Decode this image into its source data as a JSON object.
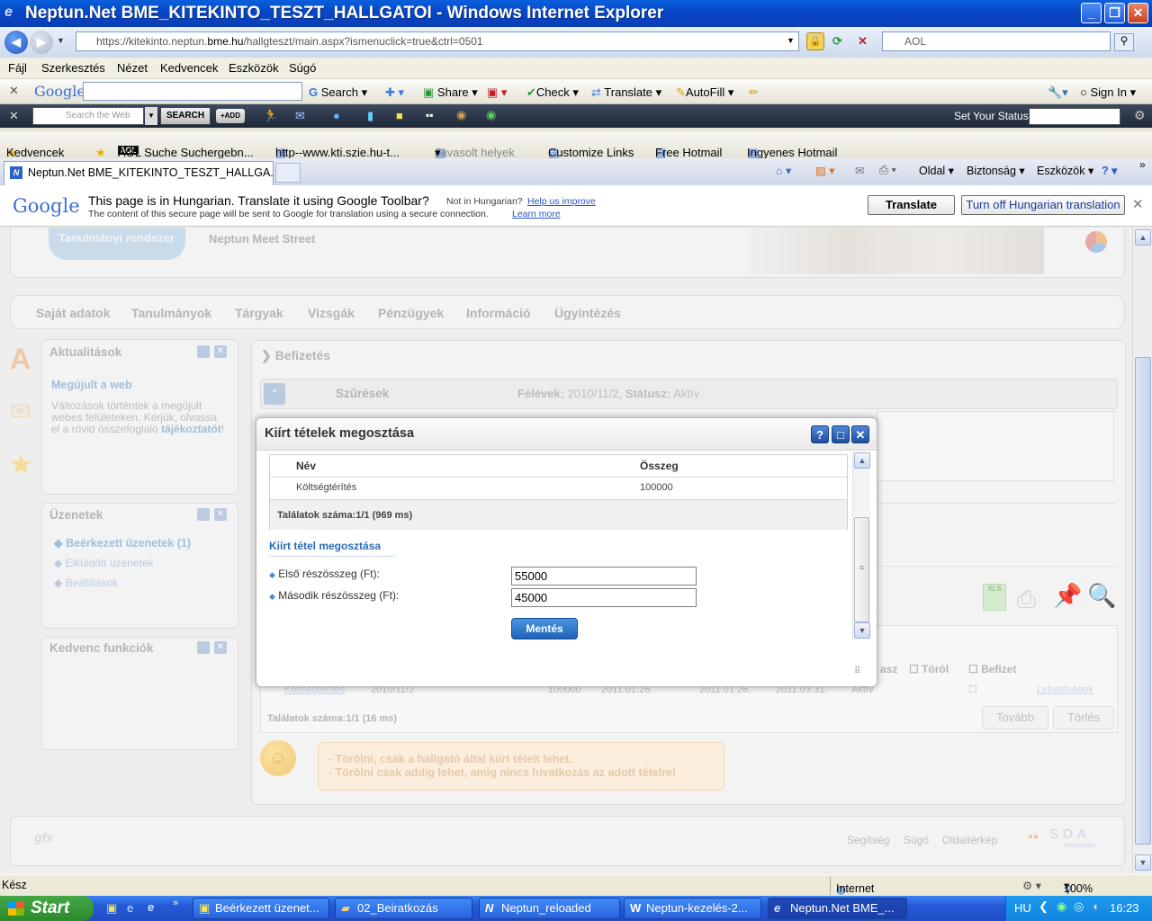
{
  "window": {
    "title": "Neptun.Net BME_KITEKINTO_TESZT_HALLGATOI - Windows Internet Explorer",
    "minimize": "_",
    "restore": "❐",
    "close": "✕"
  },
  "address": {
    "prefix": "https://kitekinto.neptun.",
    "domain": "bme.hu",
    "path": "/hallgteszt/main.aspx?ismenuclick=true&ctrl=0501",
    "search_placeholder": "AOL"
  },
  "menu": [
    "Fájl",
    "Szerkesztés",
    "Nézet",
    "Kedvencek",
    "Eszközök",
    "Súgó"
  ],
  "google_toolbar": {
    "logo": "Google",
    "search": "Search",
    "share": "Share",
    "check": "Check",
    "translate": "Translate",
    "autofill": "AutoFill",
    "signin": "Sign In"
  },
  "aol_toolbar": {
    "search_placeholder": "Search the Web",
    "search_btn": "SEARCH",
    "add_btn": "+ADD",
    "status_label": "Set Your Status:"
  },
  "favorites": {
    "label": "Kedvencek",
    "items": [
      "AOL Suche Suchergebn...",
      "http--www.kti.szie.hu-t...",
      "Javasolt helyek",
      "Customize Links",
      "Free Hotmail",
      "Ingyenes Hotmail"
    ]
  },
  "tabs": {
    "active": "Neptun.Net BME_KITEKINTO_TESZT_HALLGA...",
    "commands": [
      "Oldal",
      "Biztonság",
      "Eszközök"
    ]
  },
  "translate_bar": {
    "logo": "Google",
    "message": "This page is in Hungarian.  Translate it using Google Toolbar?",
    "not_in": "Not in Hungarian?",
    "help_link": "Help us improve",
    "secure_note": "The content of this secure page will be sent to Google for translation using a secure connection.",
    "learn_more": "Learn more",
    "translate_btn": "Translate",
    "turn_off_btn": "Turn off Hungarian translation"
  },
  "page": {
    "header_tab": "Tanulmányi rendszer",
    "header_link": "Neptun Meet Street",
    "nav": [
      "Saját adatok",
      "Tanulmányok",
      "Tárgyak",
      "Vizsgák",
      "Pénzügyek",
      "Információ",
      "Ügyintézés"
    ],
    "news": {
      "title": "Aktualitások",
      "headline": "Megújult a web",
      "body": "Változások történtek a megújult webes felületeken. Kérjük, olvassa el a rövid összefoglaló",
      "link": "tájékoztatót",
      "end": "!"
    },
    "messages": {
      "title": "Üzenetek",
      "items": [
        "Beérkezett üzenetek (1)",
        "Elküldött üzenetek",
        "Beállítások"
      ]
    },
    "favorites_box": {
      "title": "Kedvenc funkciók"
    },
    "main_title": "Befizetés",
    "filters": {
      "label": "Szűrések",
      "semester_label": "Félévek:",
      "semester_value": "2010/11/2,",
      "status_label": "Státusz:",
      "status_value": "Aktív"
    },
    "grid_headers": {
      "partial": "asz",
      "delete": "Töröl",
      "pay": "Befizet"
    },
    "grid_row": {
      "name": "Költségtérítés",
      "semester": "2010/11/2",
      "amount": "100000",
      "date1": "2011.01.26.",
      "date2": "2011.01.26.",
      "date3": "2011.03.31.",
      "status": "Aktív",
      "options": "Lehetőségek"
    },
    "grid_count": "Találatok száma:1/1 (16 ms)",
    "grid_buttons": [
      "Tovább",
      "Törlés"
    ],
    "hint": [
      "- Törölni, csak a hallgató által kiírt tételt lehet.",
      "- Törölni csak addig lehet, amíg nincs hivatkozás az adott tételre!"
    ],
    "footer_links": [
      "Segítség",
      "Súgó",
      "Oldaltérkép"
    ],
    "footer_logo": "SDA",
    "footer_sub": "Informatika",
    "footer_left_logo": "gfx"
  },
  "modal": {
    "title": "Kiírt tételek megosztása",
    "btn_help": "?",
    "btn_max": "□",
    "btn_close": "✕",
    "col_name": "Név",
    "col_amount": "Összeg",
    "row_name": "Költségtérítés",
    "row_amount": "100000",
    "count": "Találatok száma:1/1 (969 ms)",
    "section": "Kiírt tétel megosztása",
    "field1_label": "Első részösszeg (Ft):",
    "field1_value": "55000",
    "field2_label": "Második részösszeg (Ft):",
    "field2_value": "45000",
    "save": "Mentés"
  },
  "status": {
    "left": "Kész",
    "zone": "Internet",
    "zoom": "100%"
  },
  "taskbar": {
    "start": "Start",
    "tasks": [
      "Beérkezett üzenet...",
      "02_Beiratkozás",
      "Neptun_reloaded",
      "Neptun-kezelés-2...",
      "Neptun.Net BME_..."
    ],
    "lang": "HU",
    "clock": "16:23"
  }
}
